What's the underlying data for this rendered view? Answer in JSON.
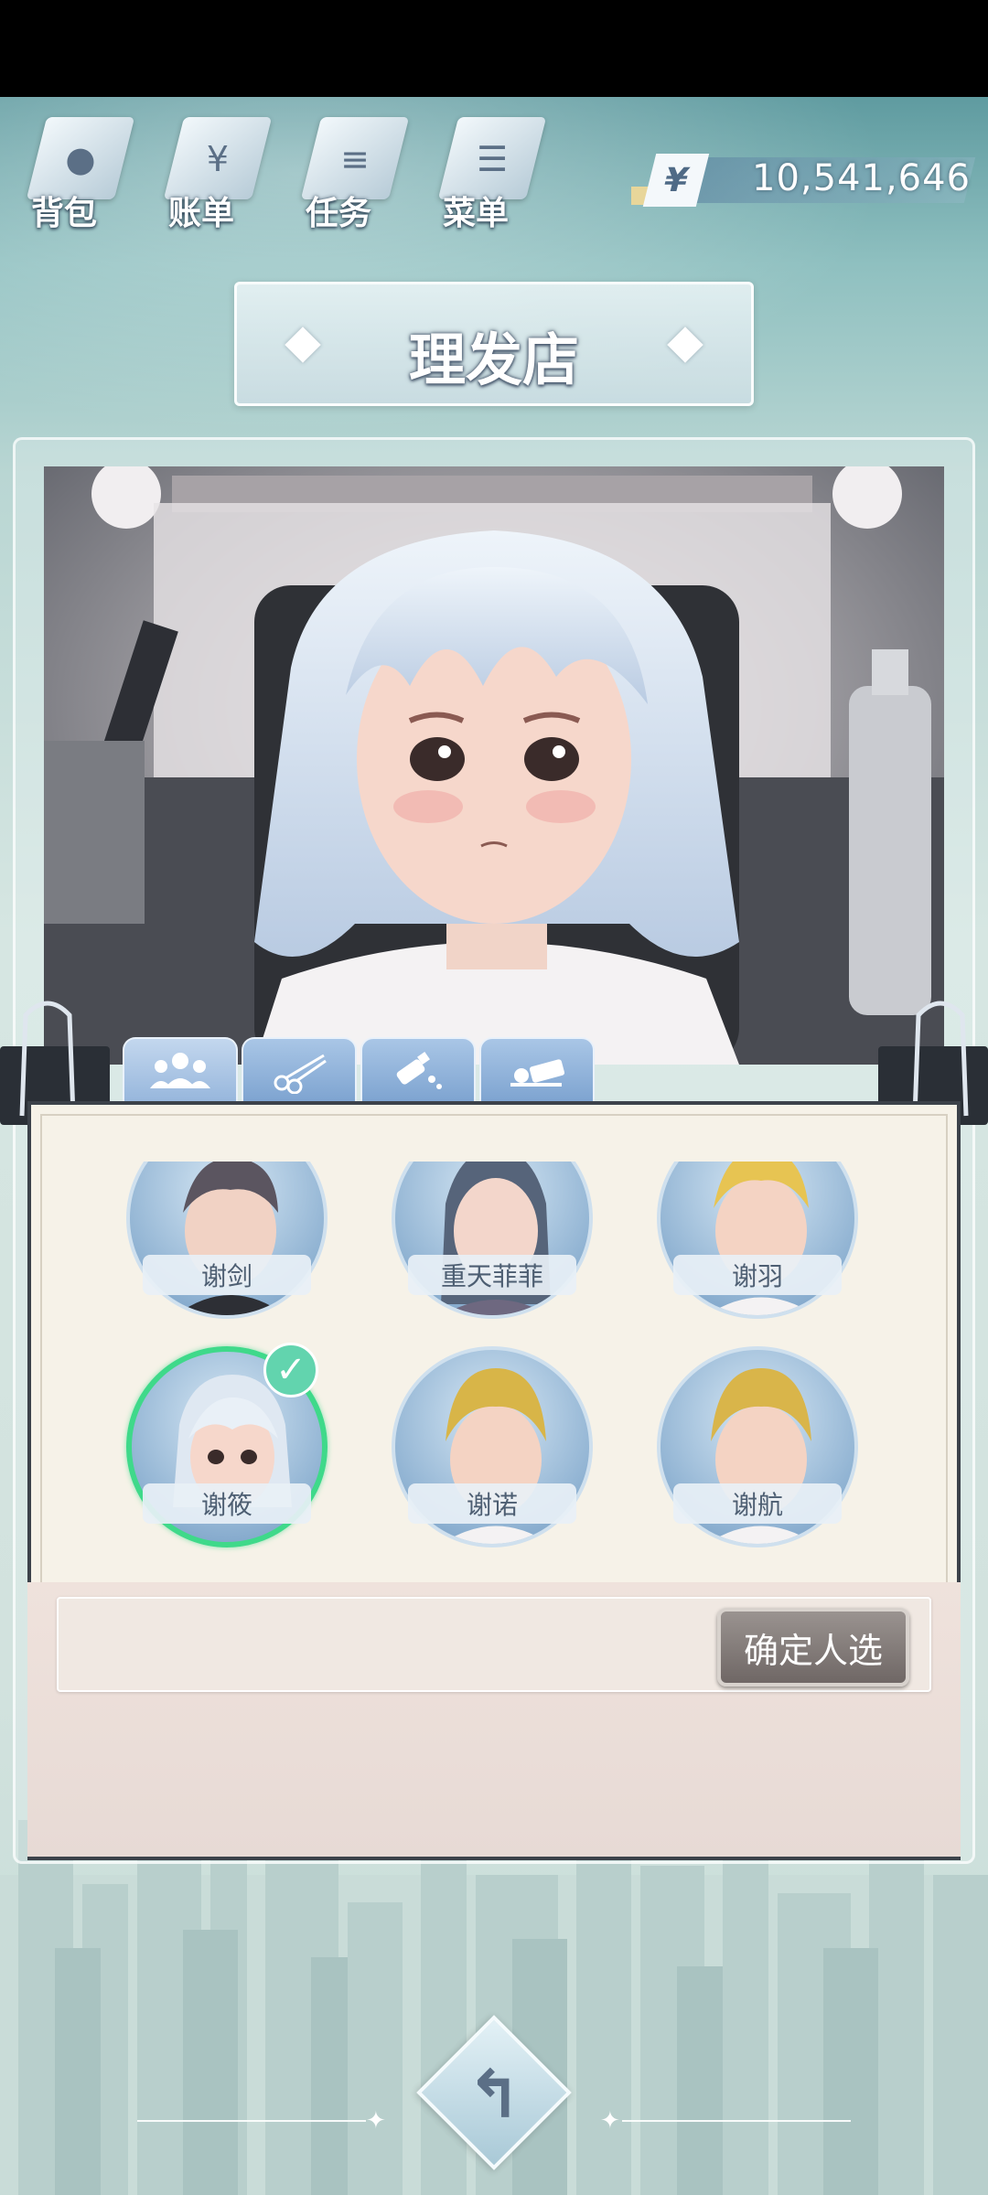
{
  "nav": {
    "items": [
      {
        "label": "背包",
        "icon": "bag-icon"
      },
      {
        "label": "账单",
        "icon": "bill-icon"
      },
      {
        "label": "任务",
        "icon": "task-icon"
      },
      {
        "label": "菜单",
        "icon": "menu-icon"
      }
    ]
  },
  "wallet": {
    "currency_symbol": "¥",
    "balance": "10,541,646"
  },
  "page": {
    "title": "理发店"
  },
  "tabs": [
    {
      "icon": "characters-icon",
      "active": true
    },
    {
      "icon": "scissors-icon",
      "active": false
    },
    {
      "icon": "dye-bottle-icon",
      "active": false
    },
    {
      "icon": "eraser-icon",
      "active": false
    }
  ],
  "roster": {
    "characters": [
      {
        "name": "谢剑",
        "hair": "#5b5560",
        "selected": false
      },
      {
        "name": "重天菲菲",
        "hair": "#56647a",
        "selected": false
      },
      {
        "name": "谢羽",
        "hair": "#e7c452",
        "selected": false
      },
      {
        "name": "谢筱",
        "hair": "#dfe8f2",
        "selected": true
      },
      {
        "name": "谢诺",
        "hair": "#d8b548",
        "selected": false
      },
      {
        "name": "谢航",
        "hair": "#d9b54a",
        "selected": false
      }
    ]
  },
  "actions": {
    "confirm_label": "确定人选",
    "back_glyph": "↰"
  },
  "colors": {
    "accent_select": "#3fd98a",
    "tab_blue": "#7da3d0"
  }
}
